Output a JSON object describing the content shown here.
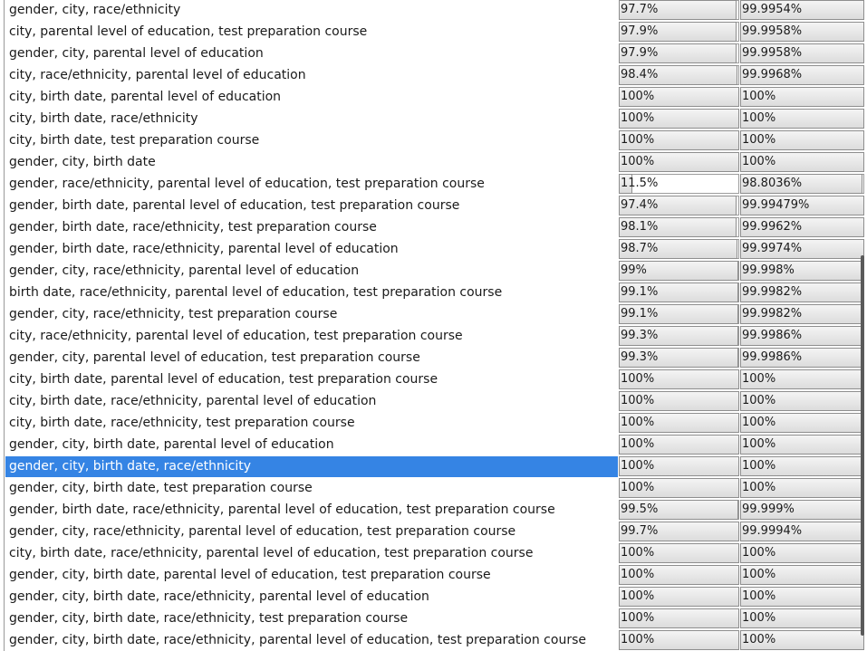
{
  "rows": [
    {
      "name": "gender, city, race/ethnicity",
      "v1": "97.7%",
      "f1": 0.977,
      "v2": "99.9954%",
      "f2": 0.999954
    },
    {
      "name": "city, parental level of education, test preparation course",
      "v1": "97.9%",
      "f1": 0.979,
      "v2": "99.9958%",
      "f2": 0.999958
    },
    {
      "name": "gender, city, parental level of education",
      "v1": "97.9%",
      "f1": 0.979,
      "v2": "99.9958%",
      "f2": 0.999958
    },
    {
      "name": "city, race/ethnicity, parental level of education",
      "v1": "98.4%",
      "f1": 0.984,
      "v2": "99.9968%",
      "f2": 0.999968
    },
    {
      "name": "city, birth date, parental level of education",
      "v1": "100%",
      "f1": 1.0,
      "v2": "100%",
      "f2": 1.0
    },
    {
      "name": "city, birth date, race/ethnicity",
      "v1": "100%",
      "f1": 1.0,
      "v2": "100%",
      "f2": 1.0
    },
    {
      "name": "city, birth date, test preparation course",
      "v1": "100%",
      "f1": 1.0,
      "v2": "100%",
      "f2": 1.0
    },
    {
      "name": "gender, city, birth date",
      "v1": "100%",
      "f1": 1.0,
      "v2": "100%",
      "f2": 1.0
    },
    {
      "name": "gender, race/ethnicity, parental level of education, test preparation course",
      "v1": "11.5%",
      "f1": 0.115,
      "v2": "98.8036%",
      "f2": 0.988036
    },
    {
      "name": "gender, birth date, parental level of education, test preparation course",
      "v1": "97.4%",
      "f1": 0.974,
      "v2": "99.99479%",
      "f2": 0.9999479
    },
    {
      "name": "gender, birth date, race/ethnicity, test preparation course",
      "v1": "98.1%",
      "f1": 0.981,
      "v2": "99.9962%",
      "f2": 0.999962
    },
    {
      "name": "gender, birth date, race/ethnicity, parental level of education",
      "v1": "98.7%",
      "f1": 0.987,
      "v2": "99.9974%",
      "f2": 0.999974
    },
    {
      "name": "gender, city, race/ethnicity, parental level of education",
      "v1": "99%",
      "f1": 0.99,
      "v2": "99.998%",
      "f2": 0.99998
    },
    {
      "name": "birth date, race/ethnicity, parental level of education, test preparation course",
      "v1": "99.1%",
      "f1": 0.991,
      "v2": "99.9982%",
      "f2": 0.999982
    },
    {
      "name": "gender, city, race/ethnicity, test preparation course",
      "v1": "99.1%",
      "f1": 0.991,
      "v2": "99.9982%",
      "f2": 0.999982
    },
    {
      "name": "city, race/ethnicity, parental level of education, test preparation course",
      "v1": "99.3%",
      "f1": 0.993,
      "v2": "99.9986%",
      "f2": 0.999986
    },
    {
      "name": "gender, city, parental level of education, test preparation course",
      "v1": "99.3%",
      "f1": 0.993,
      "v2": "99.9986%",
      "f2": 0.999986
    },
    {
      "name": "city, birth date, parental level of education, test preparation course",
      "v1": "100%",
      "f1": 1.0,
      "v2": "100%",
      "f2": 1.0
    },
    {
      "name": "city, birth date, race/ethnicity, parental level of education",
      "v1": "100%",
      "f1": 1.0,
      "v2": "100%",
      "f2": 1.0
    },
    {
      "name": "city, birth date, race/ethnicity, test preparation course",
      "v1": "100%",
      "f1": 1.0,
      "v2": "100%",
      "f2": 1.0
    },
    {
      "name": "gender, city, birth date, parental level of education",
      "v1": "100%",
      "f1": 1.0,
      "v2": "100%",
      "f2": 1.0
    },
    {
      "name": "gender, city, birth date, race/ethnicity",
      "v1": "100%",
      "f1": 1.0,
      "v2": "100%",
      "f2": 1.0,
      "selected": true
    },
    {
      "name": "gender, city, birth date, test preparation course",
      "v1": "100%",
      "f1": 1.0,
      "v2": "100%",
      "f2": 1.0
    },
    {
      "name": "gender, birth date, race/ethnicity, parental level of education, test preparation course",
      "v1": "99.5%",
      "f1": 0.995,
      "v2": "99.999%",
      "f2": 0.99999
    },
    {
      "name": "gender, city, race/ethnicity, parental level of education, test preparation course",
      "v1": "99.7%",
      "f1": 0.997,
      "v2": "99.9994%",
      "f2": 0.999994
    },
    {
      "name": "city, birth date, race/ethnicity, parental level of education, test preparation course",
      "v1": "100%",
      "f1": 1.0,
      "v2": "100%",
      "f2": 1.0
    },
    {
      "name": "gender, city, birth date, parental level of education, test preparation course",
      "v1": "100%",
      "f1": 1.0,
      "v2": "100%",
      "f2": 1.0
    },
    {
      "name": "gender, city, birth date, race/ethnicity, parental level of education",
      "v1": "100%",
      "f1": 1.0,
      "v2": "100%",
      "f2": 1.0
    },
    {
      "name": "gender, city, birth date, race/ethnicity, test preparation course",
      "v1": "100%",
      "f1": 1.0,
      "v2": "100%",
      "f2": 1.0
    },
    {
      "name": "gender, city, birth date, race/ethnicity, parental level of education, test preparation course",
      "v1": "100%",
      "f1": 1.0,
      "v2": "100%",
      "f2": 1.0
    }
  ],
  "colors": {
    "selection": "#3584e4",
    "bar_border": "#8e8e8e"
  }
}
